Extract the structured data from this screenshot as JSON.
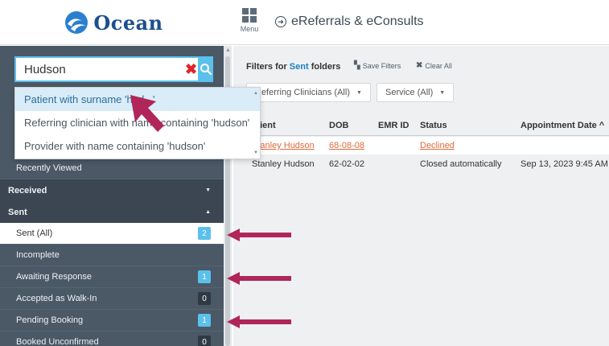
{
  "header": {
    "logo_text": "Ocean",
    "menu_label": "Menu",
    "app_title": "eReferrals & eConsults"
  },
  "search": {
    "value": "Hudson",
    "suggestions": [
      "Patient with surname 'hud...'",
      "Referring clinician with name containing 'hudson'",
      "Provider with name containing 'hudson'"
    ]
  },
  "sidebar": {
    "items": [
      {
        "label": "Recently Viewed",
        "type": "item"
      },
      {
        "label": "Received",
        "type": "section",
        "caret": "down"
      },
      {
        "label": "Sent",
        "type": "section",
        "caret": "up"
      },
      {
        "label": "Sent (All)",
        "type": "item",
        "badge": "2",
        "badge_style": "blue",
        "selected": true
      },
      {
        "label": "Incomplete",
        "type": "item"
      },
      {
        "label": "Awaiting Response",
        "type": "item",
        "badge": "1",
        "badge_style": "blue"
      },
      {
        "label": "Accepted as Walk-In",
        "type": "item",
        "badge": "0",
        "badge_style": "dark"
      },
      {
        "label": "Pending Booking",
        "type": "item",
        "badge": "1",
        "badge_style": "blue"
      },
      {
        "label": "Booked Unconfirmed",
        "type": "item",
        "badge": "0",
        "badge_style": "dark"
      }
    ]
  },
  "filters": {
    "label_prefix": "Filters for",
    "label_accent": "Sent",
    "label_suffix": "folders",
    "save_label": "Save Filters",
    "clear_label": "Clear All",
    "dropdowns": [
      "Referring Clinicians (All)",
      "Service (All)"
    ]
  },
  "table": {
    "columns": [
      "Patient",
      "DOB",
      "EMR ID",
      "Status",
      "Appointment Date"
    ],
    "rows": [
      {
        "patient": "Stanley Hudson",
        "dob": "68-08-08",
        "emr_id": "",
        "status": "Declined",
        "appointment": ""
      },
      {
        "patient": "Stanley Hudson",
        "dob": "62-02-02",
        "emr_id": "",
        "status": "Closed automatically",
        "appointment": "Sep 13, 2023 9:45 AM"
      }
    ]
  },
  "colors": {
    "sidebar_bg": "#4b5866",
    "accent": "#5bc0eb",
    "link_red": "#e06a3b",
    "annotation": "#b0265a"
  }
}
